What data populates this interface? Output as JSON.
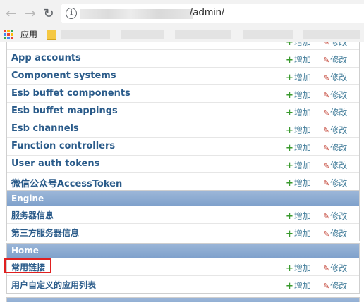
{
  "browser": {
    "url_suffix": "/admin/",
    "bookmarks": {
      "apps_label": "应用"
    },
    "icons": {
      "back": "back-arrow-icon",
      "forward": "forward-arrow-icon",
      "reload": "reload-icon",
      "info": "info-icon",
      "apps": "apps-grid-icon",
      "folder": "folder-icon"
    }
  },
  "actions": {
    "add_label": "增加",
    "change_label": "修改"
  },
  "modules": [
    {
      "caption": "",
      "rows": [
        {
          "label": "App accounts"
        },
        {
          "label": "Component systems"
        },
        {
          "label": "Esb buffet components"
        },
        {
          "label": "Esb buffet mappings"
        },
        {
          "label": "Esb channels"
        },
        {
          "label": "Function controllers"
        },
        {
          "label": "User auth tokens"
        },
        {
          "label": "微信公众号AccessToken"
        }
      ]
    },
    {
      "caption": "Engine",
      "rows": [
        {
          "label": "服务器信息"
        },
        {
          "label": "第三方服务器信息"
        }
      ]
    },
    {
      "caption": "Home",
      "rows": [
        {
          "label": "常用链接"
        },
        {
          "label": "用户自定义的应用列表"
        }
      ]
    }
  ],
  "colors": {
    "caption_bg": "#7ea0cb",
    "link": "#2a5b8a",
    "add_icon": "#3a9a2e",
    "change_icon": "#c0392b",
    "highlight": "#e02020"
  }
}
